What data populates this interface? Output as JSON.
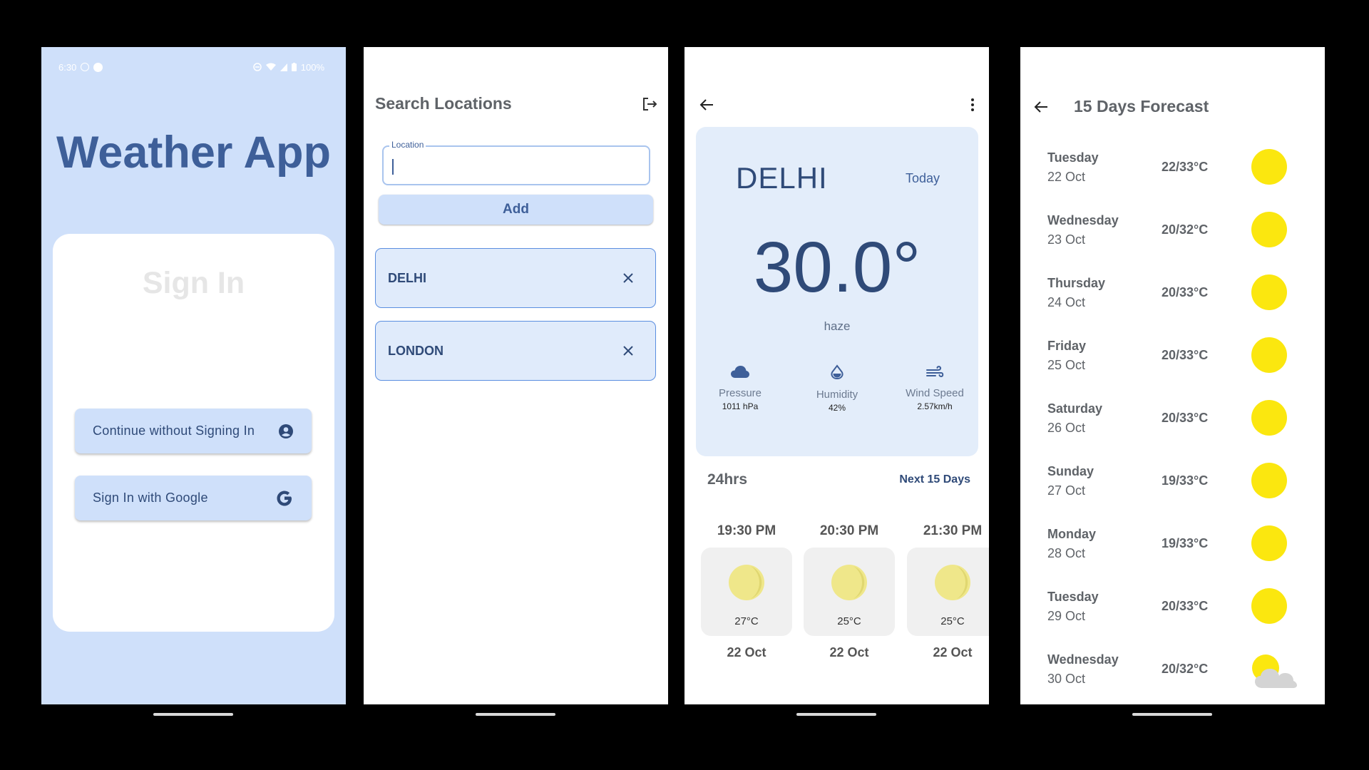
{
  "signin_screen": {
    "status": {
      "time": "6:30",
      "battery": "100%"
    },
    "app_title": "Weather App",
    "card_title": "Sign In",
    "continue_label": "Continue without Signing In",
    "google_label": "Sign In with Google"
  },
  "search_screen": {
    "title": "Search Locations",
    "location_label": "Location",
    "location_value": "",
    "add_label": "Add",
    "locations": [
      {
        "name": "DELHI"
      },
      {
        "name": "LONDON"
      }
    ]
  },
  "weather_screen": {
    "city": "DELHI",
    "day_label": "Today",
    "temperature": "30.0°",
    "condition": "haze",
    "stats": [
      {
        "label": "Pressure",
        "value": "1011 hPa",
        "icon": "cloud-icon"
      },
      {
        "label": "Humidity",
        "value": "42%",
        "icon": "droplet-icon"
      },
      {
        "label": "Wind Speed",
        "value": "2.57km/h",
        "icon": "wind-icon"
      }
    ],
    "hourly_title": "24hrs",
    "next_days_label": "Next 15 Days",
    "hourly": [
      {
        "time": "19:30 PM",
        "temp": "27°C",
        "date": "22 Oct"
      },
      {
        "time": "20:30 PM",
        "temp": "25°C",
        "date": "22 Oct"
      },
      {
        "time": "21:30 PM",
        "temp": "25°C",
        "date": "22 Oct"
      }
    ]
  },
  "forecast_screen": {
    "title": "15 Days Forecast",
    "days": [
      {
        "day": "Tuesday",
        "date": "22 Oct",
        "temp": "22/33°C",
        "icon": "sun-icon"
      },
      {
        "day": "Wednesday",
        "date": "23 Oct",
        "temp": "20/32°C",
        "icon": "sun-icon"
      },
      {
        "day": "Thursday",
        "date": "24 Oct",
        "temp": "20/33°C",
        "icon": "sun-icon"
      },
      {
        "day": "Friday",
        "date": "25 Oct",
        "temp": "20/33°C",
        "icon": "sun-icon"
      },
      {
        "day": "Saturday",
        "date": "26 Oct",
        "temp": "20/33°C",
        "icon": "sun-icon"
      },
      {
        "day": "Sunday",
        "date": "27 Oct",
        "temp": "19/33°C",
        "icon": "sun-icon"
      },
      {
        "day": "Monday",
        "date": "28 Oct",
        "temp": "19/33°C",
        "icon": "sun-icon"
      },
      {
        "day": "Tuesday",
        "date": "29 Oct",
        "temp": "20/33°C",
        "icon": "sun-icon"
      },
      {
        "day": "Wednesday",
        "date": "30 Oct",
        "temp": "20/32°C",
        "icon": "partly-cloudy-icon"
      }
    ]
  },
  "colors": {
    "primary": "#3e5f99",
    "light_blue": "#cfe0fa",
    "card_blue": "#e3edfa",
    "sun_yellow": "#fbe70f"
  }
}
